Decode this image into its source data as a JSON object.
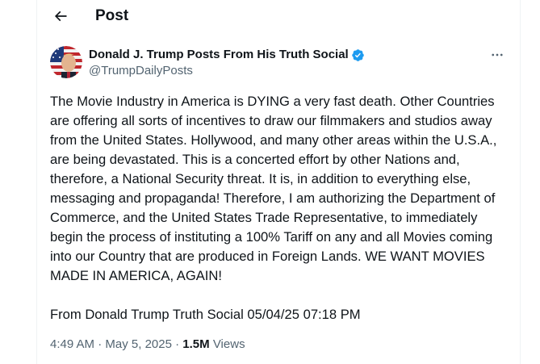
{
  "header": {
    "title": "Post",
    "back_icon": "arrow-left-icon"
  },
  "author": {
    "display_name": "Donald J. Trump Posts From His Truth Social",
    "handle": "@TrumpDailyPosts",
    "verified": true,
    "verified_color": "#1d9bf0"
  },
  "post": {
    "paragraph_1": "The Movie Industry in America is DYING a very fast death. Other Countries are offering all sorts of incentives to draw our filmmakers and studios away from the United States. Hollywood, and many other areas within the U.S.A., are being devastated. This is a concerted effort by other Nations and, therefore, a National Security threat. It is, in addition to everything else, messaging and propaganda! Therefore, I am authorizing the Department of Commerce, and the United States Trade Representative, to immediately begin the process of instituting a 100% Tariff on any and all Movies coming into our Country that are produced in Foreign Lands. WE WANT MOVIES MADE IN AMERICA, AGAIN!",
    "paragraph_2": "From Donald Trump Truth Social 05/04/25 07:18 PM"
  },
  "meta": {
    "time": "4:49 AM",
    "separator_1": " · ",
    "date": "May 5, 2025",
    "separator_2": " · ",
    "views_count": "1.5M",
    "views_label": " Views"
  },
  "colors": {
    "text": "#0f1419",
    "secondary": "#536471",
    "border": "#eff3f4"
  }
}
